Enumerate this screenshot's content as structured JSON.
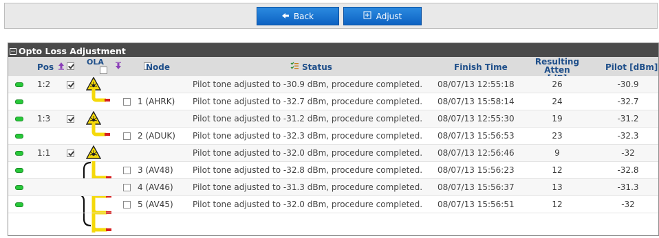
{
  "toolbar": {
    "back_label": "Back",
    "adjust_label": "Adjust"
  },
  "panel": {
    "title": "Opto Loss Adjustment"
  },
  "headers": {
    "pos": "Pos",
    "ola": "OLA",
    "node": "Node",
    "status": "Status",
    "finish_time": "Finish Time",
    "atten_line1": "Resulting Atten",
    "atten_line2": "[dB]",
    "pilot": "Pilot [dBm]"
  },
  "rows": [
    {
      "pos": "1:2",
      "node": "",
      "status": "Pilot tone adjusted to -30.9 dBm, procedure completed.",
      "finish_time": "08/07/13 12:55:18",
      "atten": "26",
      "pilot": "-30.9"
    },
    {
      "pos": "",
      "node": "1 (AHRK)",
      "status": "Pilot tone adjusted to -32.7 dBm, procedure completed.",
      "finish_time": "08/07/13 15:58:14",
      "atten": "24",
      "pilot": "-32.7"
    },
    {
      "pos": "1:3",
      "node": "",
      "status": "Pilot tone adjusted to -31.2 dBm, procedure completed.",
      "finish_time": "08/07/13 12:55:30",
      "atten": "19",
      "pilot": "-31.2"
    },
    {
      "pos": "",
      "node": "2 (ADUK)",
      "status": "Pilot tone adjusted to -32.3 dBm, procedure completed.",
      "finish_time": "08/07/13 15:56:53",
      "atten": "23",
      "pilot": "-32.3"
    },
    {
      "pos": "1:1",
      "node": "",
      "status": "Pilot tone adjusted to -32.0 dBm, procedure completed.",
      "finish_time": "08/07/13 12:56:46",
      "atten": "9",
      "pilot": "-32"
    },
    {
      "pos": "",
      "node": "3 (AV48)",
      "status": "Pilot tone adjusted to -32.8 dBm, procedure completed.",
      "finish_time": "08/07/13 15:56:23",
      "atten": "12",
      "pilot": "-32.8"
    },
    {
      "pos": "",
      "node": "4 (AV46)",
      "status": "Pilot tone adjusted to -31.3 dBm, procedure completed.",
      "finish_time": "08/07/13 15:56:37",
      "atten": "13",
      "pilot": "-31.3"
    },
    {
      "pos": "",
      "node": "5 (AV45)",
      "status": "Pilot tone adjusted to -32.0 dBm, procedure completed.",
      "finish_time": "08/07/13 15:56:51",
      "atten": "12",
      "pilot": "-32"
    }
  ],
  "colors": {
    "led_ok": "#28c83a",
    "button": "#0d62c2",
    "header_text": "#1f4f8a",
    "fiber_yellow": "#f5d90a"
  }
}
